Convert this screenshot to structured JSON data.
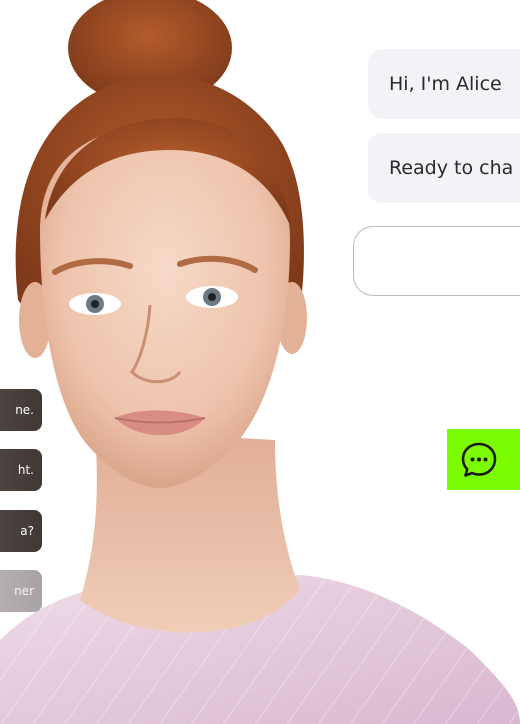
{
  "chat": {
    "messages": [
      {
        "text": "Hi, I'm Alice"
      },
      {
        "text": "Ready to cha"
      }
    ],
    "input": {
      "value": "",
      "placeholder": ""
    }
  },
  "suggestions": [
    {
      "label": "ne."
    },
    {
      "label": "ht."
    },
    {
      "label": "a?"
    },
    {
      "label": "ner"
    }
  ],
  "launcher": {
    "icon": "chat-bubble-ellipsis-icon",
    "color": "#7cfc00"
  },
  "avatar": {
    "hair_color": "#a8532a",
    "top_color": "#e7cfe0"
  }
}
